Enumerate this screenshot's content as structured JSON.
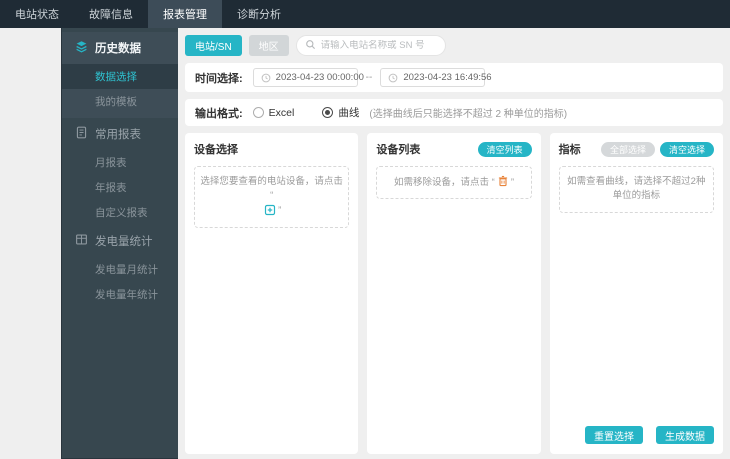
{
  "navbar": {
    "items": [
      {
        "label": "电站状态",
        "active": false
      },
      {
        "label": "故障信息",
        "active": false
      },
      {
        "label": "报表管理",
        "active": true
      },
      {
        "label": "诊断分析",
        "active": false
      }
    ]
  },
  "sidebar": {
    "groups": [
      {
        "label": "历史数据",
        "icon": "layers-icon",
        "active": true,
        "items": [
          {
            "label": "数据选择",
            "active": true
          },
          {
            "label": "我的模板",
            "active": false
          }
        ]
      },
      {
        "label": "常用报表",
        "icon": "document-icon",
        "active": false,
        "items": [
          {
            "label": "月报表",
            "active": false
          },
          {
            "label": "年报表",
            "active": false
          },
          {
            "label": "自定义报表",
            "active": false
          }
        ]
      },
      {
        "label": "发电量统计",
        "icon": "table-icon",
        "active": false,
        "items": [
          {
            "label": "发电量月统计",
            "active": false
          },
          {
            "label": "发电量年统计",
            "active": false
          }
        ]
      }
    ]
  },
  "search": {
    "station_tab": "电站/SN",
    "region_tab": "地区",
    "placeholder": "请输入电站名称或 SN 号"
  },
  "time": {
    "label": "时间选择:",
    "start": "2023-04-23 00:00:00",
    "separator": "--",
    "end": "2023-04-23 16:49:56"
  },
  "format": {
    "label": "输出格式:",
    "options": [
      {
        "label": "Excel",
        "checked": false
      },
      {
        "label": "曲线",
        "checked": true
      }
    ],
    "note": "(选择曲线后只能选择不超过 2 种单位的指标)"
  },
  "panels": {
    "device_select": {
      "title": "设备选择",
      "placeholder_prefix": "选择您要查看的电站设备，请点击 “",
      "placeholder_suffix": "”"
    },
    "device_list": {
      "title": "设备列表",
      "clear_button": "清空列表",
      "placeholder_prefix": "如需移除设备，请点击 “",
      "placeholder_suffix": "”"
    },
    "metrics": {
      "title": "指标",
      "select_all_button": "全部选择",
      "clear_button": "清空选择",
      "placeholder": "如需查看曲线，请选择不超过2种单位的指标",
      "reset_button": "重置选择",
      "generate_button": "生成数据"
    }
  },
  "colors": {
    "accent_teal": "#26b5c6",
    "trash_orange": "#e8833a",
    "sidebar_dark": "#37474f",
    "navbar_dark": "#1f2b35"
  }
}
